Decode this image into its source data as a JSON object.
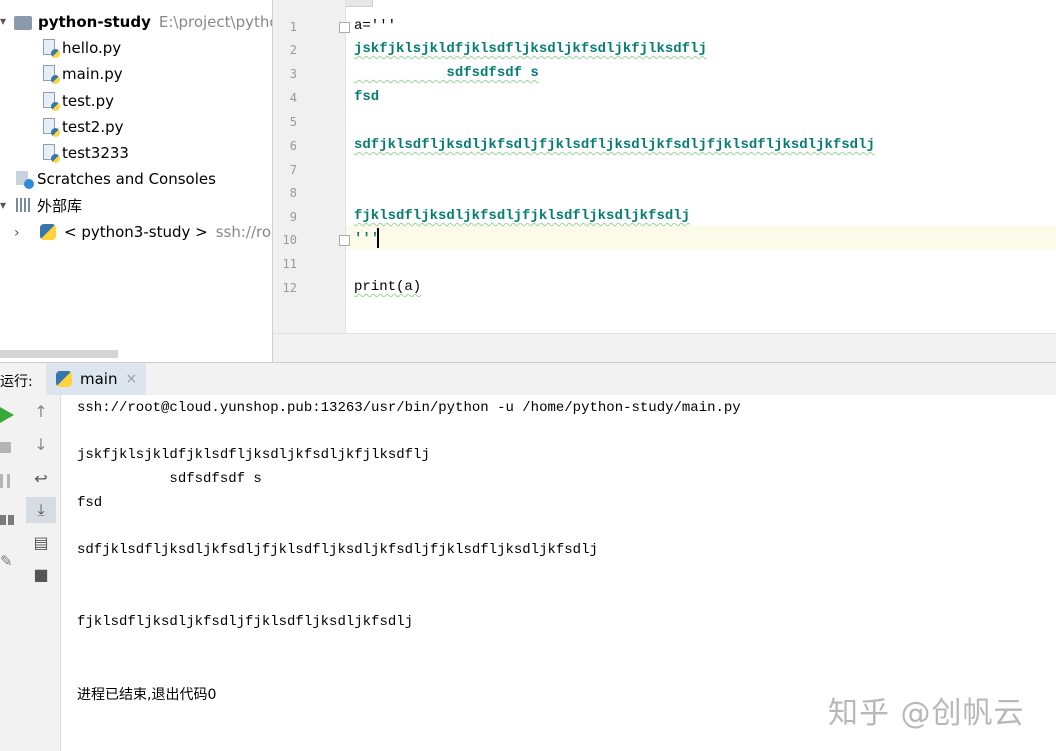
{
  "project": {
    "root_name": "python-study",
    "root_path": "E:\\project\\python",
    "files": [
      "hello.py",
      "main.py",
      "test.py",
      "test2.py",
      "test3233"
    ],
    "scratches": "Scratches and Consoles",
    "external_libs": "外部库",
    "remote_interpreter": "< python3-study >",
    "remote_hint": "ssh://roo"
  },
  "editor": {
    "line_numbers": [
      "1",
      "2",
      "3",
      "4",
      "5",
      "6",
      "7",
      "8",
      "9",
      "10",
      "11",
      "12"
    ],
    "lines": [
      "a='''",
      "jskfjklsjkldfjklsdfljksdljkfsdljkfjlksdflj",
      "           sdfsdfsdf s",
      "fsd",
      "",
      "sdfjklsdfljksdljkfsdljfjklsdfljksdljkfsdljfjklsdfljksdljkfsdlj",
      "",
      "",
      "fjklsdfljksdljkfsdljfjklsdfljksdljkfsdlj",
      "'''",
      "",
      "print(a)"
    ]
  },
  "run": {
    "label": "运行:",
    "tab": "main",
    "close": "×",
    "output": [
      "ssh://root@cloud.yunshop.pub:13263/usr/bin/python -u /home/python-study/main.py",
      "",
      "jskfjklsjkldfjklsdfljksdljkfsdljkfjlksdflj",
      "           sdfsdfsdf s",
      "fsd",
      "",
      "sdfjklsdfljksdljkfsdljfjklsdfljksdljkfsdljfjklsdfljksdljkfsdlj",
      "",
      "",
      "fjklsdfljksdljkfsdljfjklsdfljksdljkfsdlj",
      "",
      "",
      "进程已结束,退出代码0"
    ]
  },
  "watermark": "知乎 @创帆云",
  "colors": {
    "string": "#067d73",
    "current_line": "#fcfae8",
    "run_green": "#3aa83a"
  }
}
